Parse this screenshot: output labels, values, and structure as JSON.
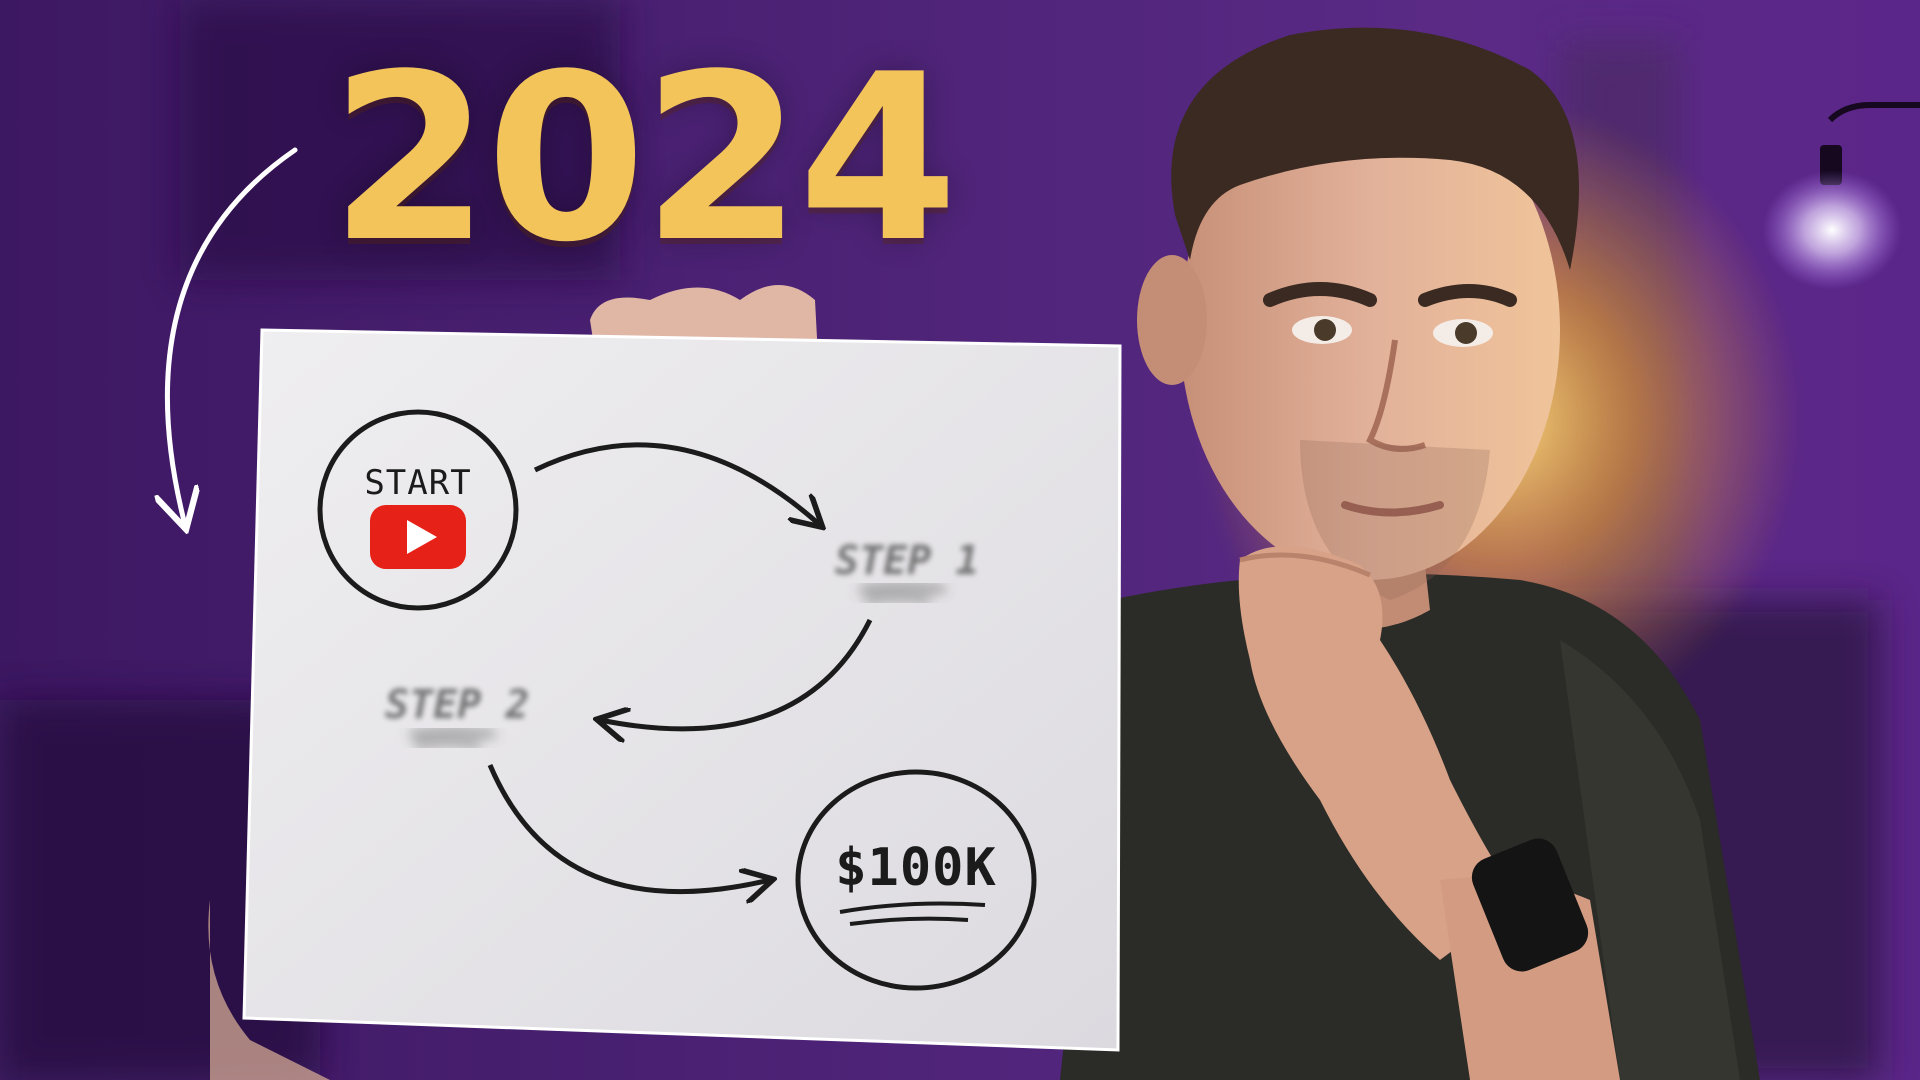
{
  "headline": {
    "year": "2024"
  },
  "sketch": {
    "start_label": "START",
    "step1_label": "STEP 1",
    "step2_label": "STEP 2",
    "goal_label": "$100K"
  },
  "colors": {
    "background_purple": "#3a1660",
    "headline_gold": "#f2c45a",
    "warm_glow": "#f5b530",
    "paper": "#e9e7ea",
    "youtube_red": "#e62117",
    "shirt": "#2b2b27",
    "skin": "#d9a58a",
    "hair": "#3a2a22"
  },
  "icons": {
    "start_icon": "youtube-play-icon"
  }
}
